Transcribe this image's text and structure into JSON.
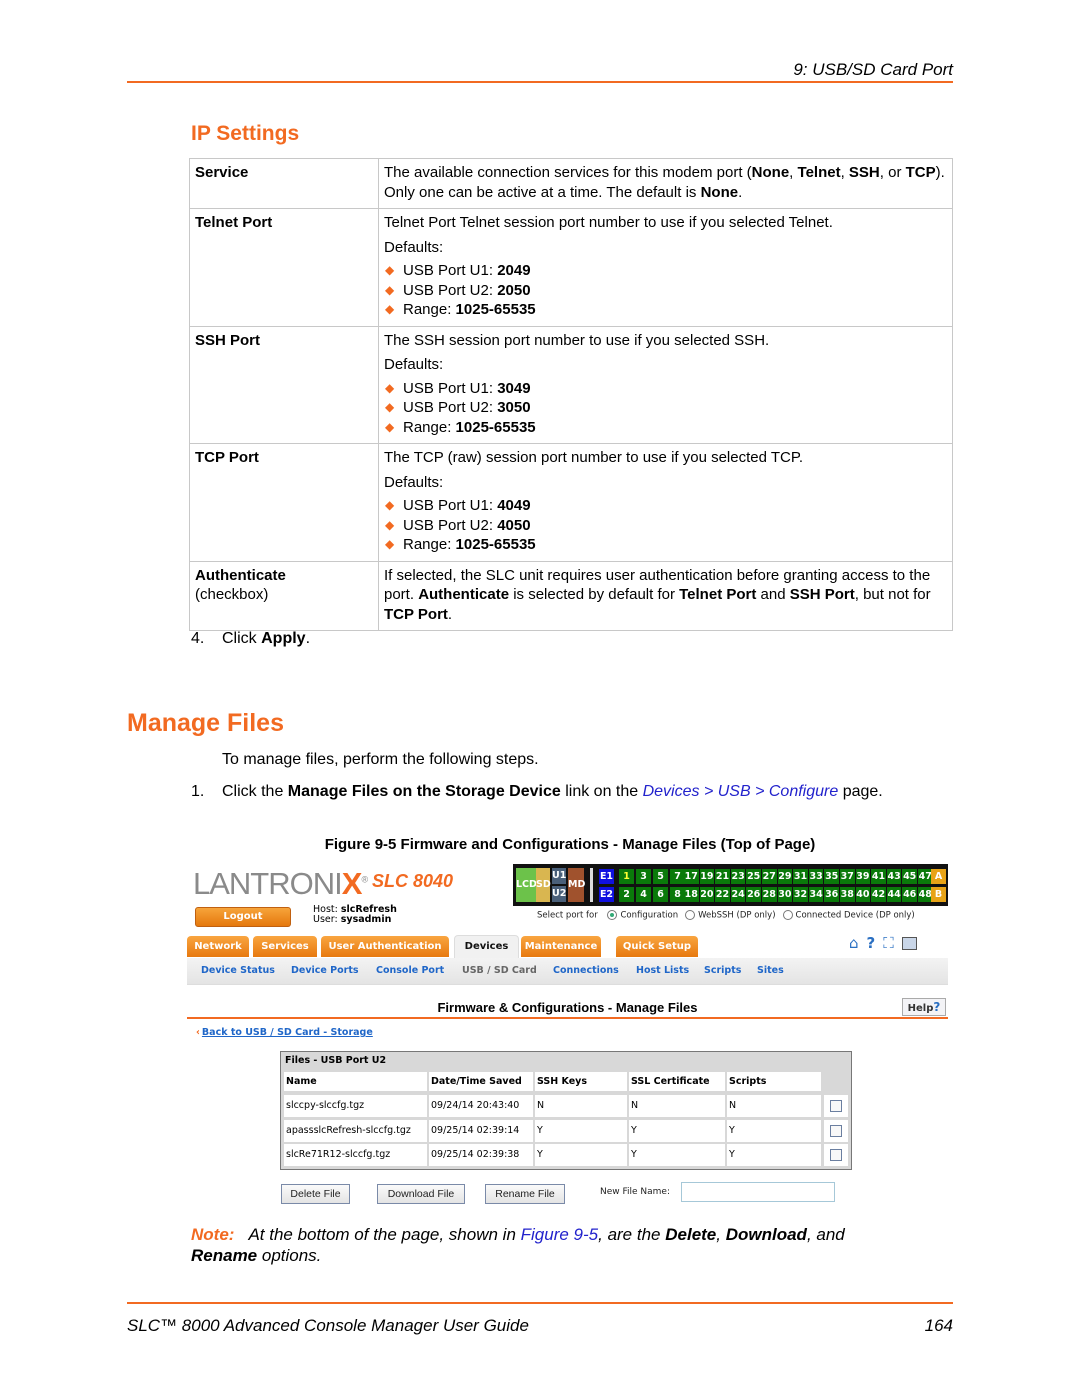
{
  "header": {
    "chapter": "9: USB/SD Card Port"
  },
  "ip_settings": {
    "title": "IP Settings",
    "rows": [
      {
        "key": "Service",
        "sub": "",
        "html": "The available connection services for this modem port (<b>None</b>, <b>Telnet</b>, <b>SSH</b>, or <b>TCP</b>). Only one can be active at a time. The default is <b>None</b>."
      },
      {
        "key": "Telnet Port",
        "sub": "",
        "text": "Telnet Port Telnet session port number to use if you selected Telnet.",
        "defaults_label": "Defaults:",
        "bullets": [
          {
            "label": "USB Port U1: ",
            "value": "2049"
          },
          {
            "label": "USB Port U2: ",
            "value": "2050"
          },
          {
            "label": "Range: ",
            "value": "1025-65535"
          }
        ]
      },
      {
        "key": "SSH Port",
        "sub": "",
        "text": "The SSH session port number  to use if you selected SSH.",
        "defaults_label": "Defaults:",
        "bullets": [
          {
            "label": "USB Port U1: ",
            "value": "3049"
          },
          {
            "label": "USB Port U2: ",
            "value": "3050"
          },
          {
            "label": "Range: ",
            "value": "1025-65535"
          }
        ]
      },
      {
        "key": "TCP Port",
        "sub": "",
        "text": "The TCP (raw) session port number to use if you selected TCP.",
        "defaults_label": "Defaults:",
        "bullets": [
          {
            "label": "USB Port U1: ",
            "value": "4049"
          },
          {
            "label": "USB Port U2: ",
            "value": "4050"
          },
          {
            "label": "Range: ",
            "value": "1025-65535"
          }
        ]
      },
      {
        "key": "Authenticate",
        "sub": "(checkbox)",
        "html": "If selected, the SLC unit requires user authentication before granting access to the port. <b>Authenticate</b> is selected by default for <b>Telnet Port</b> and <b>SSH Port</b>, but not for <b>TCP Port</b>."
      }
    ],
    "step4": {
      "num": "4.",
      "pre": "Click ",
      "bold": "Apply",
      "post": "."
    }
  },
  "manage_files": {
    "title": "Manage Files",
    "intro": "To manage files, perform the following steps.",
    "step1": {
      "num": "1.",
      "pre": "Click the ",
      "bold": "Manage Files on the Storage Device",
      "mid": " link on the ",
      "link": "Devices > USB > Configure",
      "post": " page."
    },
    "figure_caption": "Figure 9-5  Firmware and Configurations - Manage Files (Top of Page)"
  },
  "screenshot": {
    "logo": {
      "text": "LANTRONI",
      "x": "X",
      "reg": "®"
    },
    "model": "SLC 8040",
    "logout_label": "Logout",
    "host_label": "Host: ",
    "host": "slcRefresh",
    "user_label": "User: ",
    "user": "sysadmin",
    "port_panel": {
      "left_blocks": [
        "LCD",
        "SD",
        "U1",
        "U2",
        "MD"
      ],
      "row1": [
        "E1",
        "1",
        "3",
        "5",
        "7",
        "17",
        "19",
        "21",
        "23",
        "25",
        "27",
        "29",
        "31",
        "33",
        "35",
        "37",
        "39",
        "41",
        "43",
        "45",
        "47",
        "A"
      ],
      "row2": [
        "E2",
        "2",
        "4",
        "6",
        "8",
        "18",
        "20",
        "22",
        "24",
        "26",
        "28",
        "30",
        "32",
        "34",
        "36",
        "38",
        "40",
        "42",
        "44",
        "46",
        "48",
        "B"
      ],
      "colors": {
        "green": "#0a7a0a",
        "lcd": "#6cc24a",
        "sd": "#d9b650",
        "u": "#4a607a",
        "md": "#a0522d",
        "e": "#1010e0",
        "ab": "#e8a317",
        "selected_text": "#ffff33"
      }
    },
    "select_port": {
      "label": "Select port for",
      "options": [
        {
          "label": "Configuration",
          "selected": true
        },
        {
          "label": "WebSSH (DP only)",
          "selected": false
        },
        {
          "label": "Connected Device (DP only)",
          "selected": false
        }
      ]
    },
    "tabs": [
      {
        "label": "Network"
      },
      {
        "label": "Services"
      },
      {
        "label": "User Authentication"
      },
      {
        "label": "Devices",
        "active": true
      },
      {
        "label": "Maintenance"
      },
      {
        "label": "Quick Setup"
      }
    ],
    "tool_icons": [
      "home-icon",
      "help-icon",
      "fullscreen-icon",
      "screen-icon"
    ],
    "subnav": [
      {
        "label": "Device Status"
      },
      {
        "label": "Device Ports"
      },
      {
        "label": "Console Port"
      },
      {
        "label": "USB / SD Card",
        "current": true
      },
      {
        "label": "Connections"
      },
      {
        "label": "Host Lists"
      },
      {
        "label": "Scripts"
      },
      {
        "label": "Sites"
      }
    ],
    "page_title": "Firmware & Configurations - Manage Files",
    "help_label": "Help",
    "help_q": "?",
    "back_link": "Back to USB / SD Card - Storage",
    "files": {
      "caption": "Files - USB Port U2",
      "columns": [
        "Name",
        "Date/Time Saved",
        "SSH Keys",
        "SSL Certificate",
        "Scripts"
      ],
      "rows": [
        [
          "slccpy-slccfg.tgz",
          "09/24/14 20:43:40",
          "N",
          "N",
          "N"
        ],
        [
          "apassslcRefresh-slccfg.tgz",
          "09/25/14 02:39:14",
          "Y",
          "Y",
          "Y"
        ],
        [
          "slcRe71R12-slccfg.tgz",
          "09/25/14 02:39:38",
          "Y",
          "Y",
          "Y"
        ]
      ]
    },
    "buttons": {
      "delete": "Delete File",
      "download": "Download File",
      "rename": "Rename File"
    },
    "new_file_name_label": "New File Name:",
    "new_file_name_value": ""
  },
  "note": {
    "label": "Note:",
    "pre": "At the bottom of the page, shown in ",
    "link": "Figure 9-5",
    "mid": ", are the ",
    "b1": "Delete",
    "sep1": ", ",
    "b2": "Download",
    "sep2": ", and ",
    "b3": "Rename",
    "post": " options."
  },
  "footer": {
    "title": "SLC™ 8000 Advanced Console Manager User Guide",
    "page": "164"
  },
  "colors": {
    "accent": "#f26a21",
    "link": "#2222cc",
    "nav_link": "#1f66c8"
  }
}
